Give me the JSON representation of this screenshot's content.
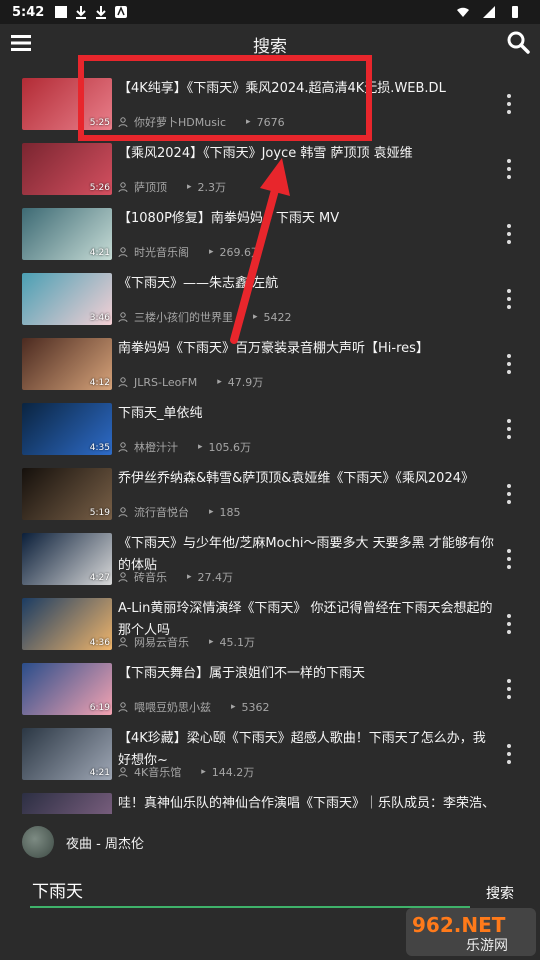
{
  "status_bar": {
    "time": "5:42"
  },
  "app_bar": {
    "title": "搜索"
  },
  "results": [
    {
      "title": "【4K纯享】《下雨天》乘风2024.超高清4K无损.WEB.DL",
      "author": "你好萝卜HDMusic",
      "plays": "7676",
      "duration": "5:25"
    },
    {
      "title": "【乘风2024】《下雨天》Joyce 韩雪 萨顶顶 袁娅维",
      "author": "萨顶顶",
      "plays": "2.3万",
      "duration": "5:26"
    },
    {
      "title": "【1080P修复】南拳妈妈 - 下雨天 MV",
      "author": "时光音乐阁",
      "plays": "269.6万",
      "duration": "4:21"
    },
    {
      "title": "《下雨天》——朱志鑫 左航",
      "author": "三楼小孩们的世界里",
      "plays": "5422",
      "duration": "3:46"
    },
    {
      "title": "南拳妈妈《下雨天》百万豪装录音棚大声听【Hi-res】",
      "author": "JLRS-LeoFM",
      "plays": "47.9万",
      "duration": "4:12"
    },
    {
      "title": "下雨天_单依纯",
      "author": "林橙汁汁",
      "plays": "105.6万",
      "duration": "4:35"
    },
    {
      "title": "乔伊丝乔纳森&韩雪&萨顶顶&袁娅维《下雨天》《乘风2024》",
      "author": "流行音悦台",
      "plays": "185",
      "duration": "5:19"
    },
    {
      "title": "《下雨天》与少年他/芝麻Mochi～雨要多大 天要多黑 才能够有你的体贴",
      "author": "砖音乐",
      "plays": "27.4万",
      "duration": "4:27"
    },
    {
      "title": "A-Lin黄丽玲深情演绎《下雨天》 你还记得曾经在下雨天会想起的那个人吗",
      "author": "网易云音乐",
      "plays": "45.1万",
      "duration": "4:36"
    },
    {
      "title": "【下雨天舞台】属于浪姐们不一样的下雨天",
      "author": "喂喂豆奶思小兹",
      "plays": "5362",
      "duration": "6:19"
    },
    {
      "title": "【4K珍藏】梁心颐《下雨天》超感人歌曲！下雨天了怎么办，我好想你~",
      "author": "4K音乐馆",
      "plays": "144.2万",
      "duration": "4:21"
    },
    {
      "title": "哇！真神仙乐队的神仙合作演唱《下雨天》｜乐队成员：李荣浩、汪苏泷、张韶涵、薛之谦、萧敬腾",
      "author": "",
      "plays": "",
      "duration": ""
    }
  ],
  "now_playing": {
    "title": "夜曲 - 周杰伦"
  },
  "search": {
    "query": "下雨天",
    "button_label": "搜索"
  },
  "watermark": {
    "text_top": "962.NET",
    "text_bottom": "乐游网"
  },
  "colors": {
    "background": "#2b2b2b",
    "accent": "#3fb26a",
    "annotation": "#e8262c"
  }
}
